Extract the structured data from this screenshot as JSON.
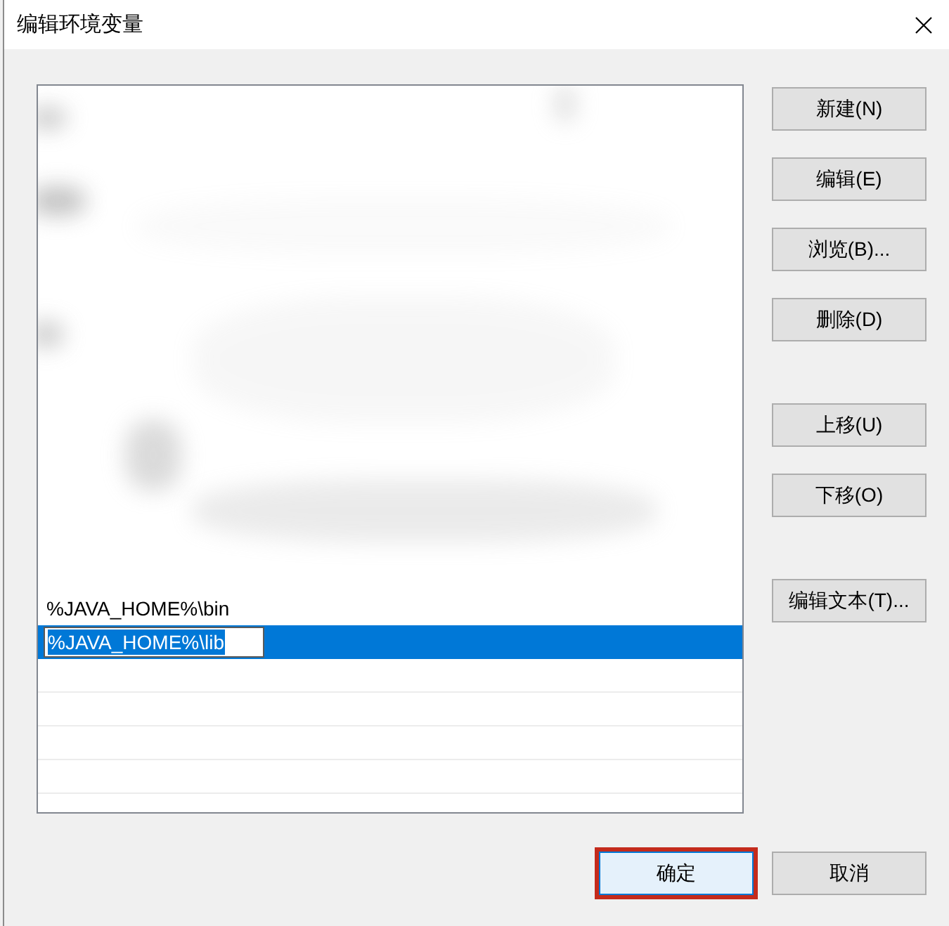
{
  "window": {
    "title": "编辑环境变量"
  },
  "list": {
    "blurred_top": true,
    "entries": [
      {
        "text": "%JAVA_HOME%\\bin",
        "selected": false,
        "editing": false
      },
      {
        "text": "%JAVA_HOME%\\lib",
        "selected": true,
        "editing": true
      }
    ]
  },
  "side_button_groups": [
    {
      "buttons": [
        {
          "label": "新建(N)"
        },
        {
          "label": "编辑(E)"
        },
        {
          "label": "浏览(B)..."
        },
        {
          "label": "删除(D)"
        }
      ]
    },
    {
      "buttons": [
        {
          "label": "上移(U)"
        },
        {
          "label": "下移(O)"
        }
      ]
    },
    {
      "buttons": [
        {
          "label": "编辑文本(T)..."
        }
      ]
    }
  ],
  "footer_buttons": [
    {
      "label": "确定",
      "default": true,
      "highlighted": true
    },
    {
      "label": "取消",
      "default": false,
      "highlighted": false
    }
  ]
}
